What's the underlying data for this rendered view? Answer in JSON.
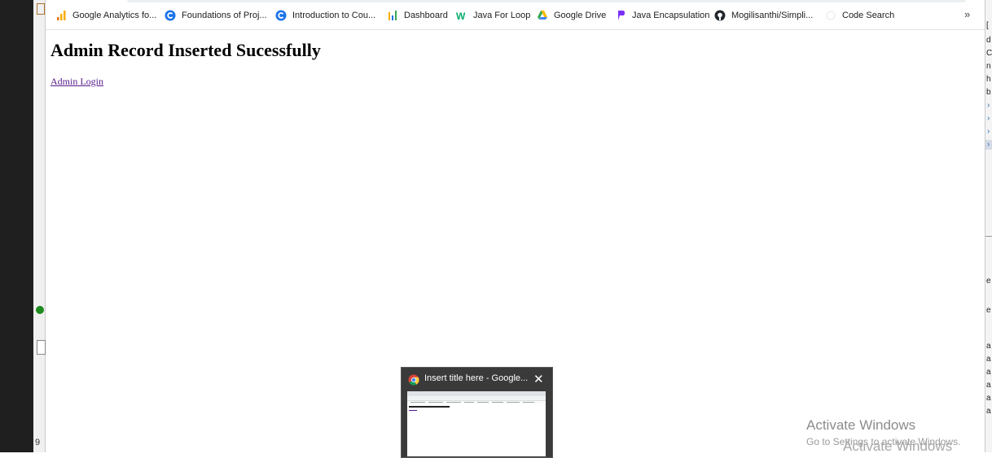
{
  "bookmarks": [
    {
      "label": "Google Analytics fo...",
      "icon": "analytics-icon"
    },
    {
      "label": "Foundations of Proj...",
      "icon": "coursera-icon"
    },
    {
      "label": "Introduction to Cou...",
      "icon": "coursera-icon"
    },
    {
      "label": "Dashboard",
      "icon": "dashboard-icon"
    },
    {
      "label": "Java For Loop",
      "icon": "w3schools-icon"
    },
    {
      "label": "Google Drive",
      "icon": "google-drive-icon"
    },
    {
      "label": "Java Encapsulation",
      "icon": "bookmark-p-icon"
    },
    {
      "label": "Mogilisanthi/Simpli...",
      "icon": "github-icon"
    },
    {
      "label": "Code Search",
      "icon": "code-search-icon"
    }
  ],
  "more_label": "»",
  "page": {
    "heading": "Admin Record Inserted Sucessfully",
    "link": "Admin Login"
  },
  "taskbar_preview": {
    "title": "Insert title here - Google...",
    "close": "✕"
  },
  "left_panel": {
    "line_number": "9"
  },
  "watermark": {
    "title": "Activate Windows",
    "subtitle": "Go to Settings to activate Windows.",
    "ghost": "Activate Windows"
  },
  "colors": {
    "link": "#551a8b",
    "coursera_blue": "#1a73e8",
    "analytics_orange": "#f9ab00"
  }
}
